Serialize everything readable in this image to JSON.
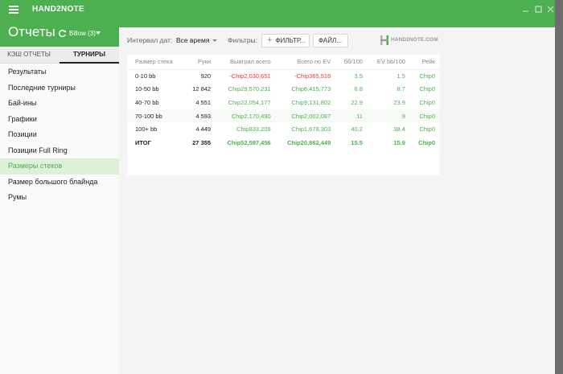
{
  "app": {
    "title": "HAND2NOTE"
  },
  "header": {
    "page_title": "Отчеты",
    "account": "Billow (3)"
  },
  "sidebar": {
    "tabs": [
      {
        "label": "КЭШ ОТЧЕТЫ"
      },
      {
        "label": "ТУРНИРЫ"
      }
    ],
    "items": [
      {
        "label": "Результаты"
      },
      {
        "label": "Последние турниры"
      },
      {
        "label": "Бай-ины"
      },
      {
        "label": "Графики"
      },
      {
        "label": "Позиции"
      },
      {
        "label": "Позиции Full Ring"
      },
      {
        "label": "Размеры стеков"
      },
      {
        "label": "Размер большого блайнда"
      },
      {
        "label": "Румы"
      }
    ]
  },
  "toolbar": {
    "date_label": "Интервал дат:",
    "date_value": "Все время",
    "filters_label": "Фильтры:",
    "filters_button": "ФИЛЬТР...",
    "file_button": "ФАЙЛ...",
    "logo_text": "HAND2NOTE.COM"
  },
  "table": {
    "columns": [
      "Размер стека",
      "Руки",
      "Выиграл всего",
      "Всего по EV",
      "бб/100",
      "EV bb/100",
      "Рейк"
    ],
    "rows": [
      {
        "stack": "0-10 bb",
        "hands": "920",
        "won": "-Chip2,030,651",
        "ev": "-Chip365,516",
        "bb100": "3.5",
        "evbb": "1.5",
        "rake": "Chip0"
      },
      {
        "stack": "10-50 bb",
        "hands": "12 842",
        "won": "Chip29,570,231",
        "ev": "Chip8,415,773",
        "bb100": "6.8",
        "evbb": "8.7",
        "rake": "Chip0"
      },
      {
        "stack": "40-70 bb",
        "hands": "4 551",
        "won": "Chip22,054,177",
        "ev": "Chip9,131,802",
        "bb100": "22.9",
        "evbb": "23.9",
        "rake": "Chip0"
      },
      {
        "stack": "70-100 bb",
        "hands": "4 593",
        "won": "Chip2,170,490",
        "ev": "Chip2,002,087",
        "bb100": "11",
        "evbb": "9",
        "rake": "Chip0"
      },
      {
        "stack": "100+ bb",
        "hands": "4 449",
        "won": "Chip833,209",
        "ev": "Chip1,678,303",
        "bb100": "40.2",
        "evbb": "38.4",
        "rake": "Chip0"
      }
    ],
    "total": {
      "stack": "ИТОГ",
      "hands": "27 355",
      "won": "Chip52,597,456",
      "ev": "Chip20,862,449",
      "bb100": "15.5",
      "evbb": "15.9",
      "rake": "Chip0"
    }
  },
  "colors": {
    "accent": "#4caf50",
    "negative": "#e53935",
    "active_bg": "#dff0d8"
  }
}
